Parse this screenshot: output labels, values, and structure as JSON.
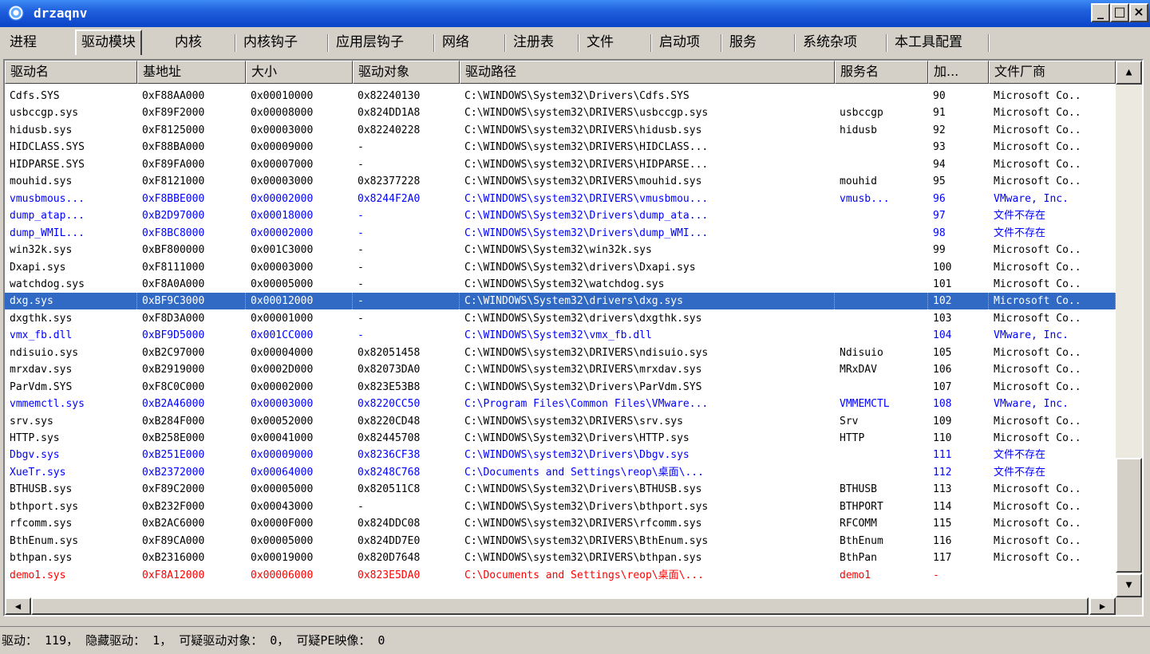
{
  "window": {
    "title": "drzaqnv",
    "minimize": "_",
    "maximize": "□",
    "close": "×"
  },
  "tabs": [
    "进程",
    "驱动模块",
    "内核",
    "内核钩子",
    "应用层钩子",
    "网络",
    "注册表",
    "文件",
    "启动项",
    "服务",
    "系统杂项",
    "本工具配置"
  ],
  "active_tab": "驱动模块",
  "columns": [
    "驱动名",
    "基地址",
    "大小",
    "驱动对象",
    "驱动路径",
    "服务名",
    "加...",
    "文件厂商"
  ],
  "colors": {
    "normal": "#000000",
    "blue": "#0000ff",
    "red": "#ff0000",
    "selected_bg": "#316ac5"
  },
  "rows": [
    {
      "name": "Cdfs.SYS",
      "base": "0xF88AA000",
      "size": "0x00010000",
      "obj": "0x82240130",
      "path": "C:\\WINDOWS\\System32\\Drivers\\Cdfs.SYS",
      "svc": "",
      "load": "90",
      "vendor": "Microsoft Co..",
      "color": "normal"
    },
    {
      "name": "usbccgp.sys",
      "base": "0xF89F2000",
      "size": "0x00008000",
      "obj": "0x824DD1A8",
      "path": "C:\\WINDOWS\\system32\\DRIVERS\\usbccgp.sys",
      "svc": "usbccgp",
      "load": "91",
      "vendor": "Microsoft Co..",
      "color": "normal"
    },
    {
      "name": "hidusb.sys",
      "base": "0xF8125000",
      "size": "0x00003000",
      "obj": "0x82240228",
      "path": "C:\\WINDOWS\\system32\\DRIVERS\\hidusb.sys",
      "svc": "hidusb",
      "load": "92",
      "vendor": "Microsoft Co..",
      "color": "normal"
    },
    {
      "name": "HIDCLASS.SYS",
      "base": "0xF88BA000",
      "size": "0x00009000",
      "obj": "-",
      "path": "C:\\WINDOWS\\system32\\DRIVERS\\HIDCLASS...",
      "svc": "",
      "load": "93",
      "vendor": "Microsoft Co..",
      "color": "normal"
    },
    {
      "name": "HIDPARSE.SYS",
      "base": "0xF89FA000",
      "size": "0x00007000",
      "obj": "-",
      "path": "C:\\WINDOWS\\system32\\DRIVERS\\HIDPARSE...",
      "svc": "",
      "load": "94",
      "vendor": "Microsoft Co..",
      "color": "normal"
    },
    {
      "name": "mouhid.sys",
      "base": "0xF8121000",
      "size": "0x00003000",
      "obj": "0x82377228",
      "path": "C:\\WINDOWS\\system32\\DRIVERS\\mouhid.sys",
      "svc": "mouhid",
      "load": "95",
      "vendor": "Microsoft Co..",
      "color": "normal"
    },
    {
      "name": "vmusbmous...",
      "base": "0xF8BBE000",
      "size": "0x00002000",
      "obj": "0x8244F2A0",
      "path": "C:\\WINDOWS\\system32\\DRIVERS\\vmusbmou...",
      "svc": "vmusb...",
      "load": "96",
      "vendor": "VMware, Inc.",
      "color": "blue"
    },
    {
      "name": "dump_atap...",
      "base": "0xB2D97000",
      "size": "0x00018000",
      "obj": "-",
      "path": "C:\\WINDOWS\\System32\\Drivers\\dump_ata...",
      "svc": "",
      "load": "97",
      "vendor": "文件不存在",
      "color": "blue"
    },
    {
      "name": "dump_WMIL...",
      "base": "0xF8BC8000",
      "size": "0x00002000",
      "obj": "-",
      "path": "C:\\WINDOWS\\System32\\Drivers\\dump_WMI...",
      "svc": "",
      "load": "98",
      "vendor": "文件不存在",
      "color": "blue"
    },
    {
      "name": "win32k.sys",
      "base": "0xBF800000",
      "size": "0x001C3000",
      "obj": "-",
      "path": "C:\\WINDOWS\\System32\\win32k.sys",
      "svc": "",
      "load": "99",
      "vendor": "Microsoft Co..",
      "color": "normal"
    },
    {
      "name": "Dxapi.sys",
      "base": "0xF8111000",
      "size": "0x00003000",
      "obj": "-",
      "path": "C:\\WINDOWS\\System32\\drivers\\Dxapi.sys",
      "svc": "",
      "load": "100",
      "vendor": "Microsoft Co..",
      "color": "normal"
    },
    {
      "name": "watchdog.sys",
      "base": "0xF8A0A000",
      "size": "0x00005000",
      "obj": "-",
      "path": "C:\\WINDOWS\\System32\\watchdog.sys",
      "svc": "",
      "load": "101",
      "vendor": "Microsoft Co..",
      "color": "normal"
    },
    {
      "name": "dxg.sys",
      "base": "0xBF9C3000",
      "size": "0x00012000",
      "obj": "-",
      "path": "C:\\WINDOWS\\System32\\drivers\\dxg.sys",
      "svc": "",
      "load": "102",
      "vendor": "Microsoft Co..",
      "color": "normal",
      "selected": true
    },
    {
      "name": "dxgthk.sys",
      "base": "0xF8D3A000",
      "size": "0x00001000",
      "obj": "-",
      "path": "C:\\WINDOWS\\System32\\drivers\\dxgthk.sys",
      "svc": "",
      "load": "103",
      "vendor": "Microsoft Co..",
      "color": "normal"
    },
    {
      "name": "vmx_fb.dll",
      "base": "0xBF9D5000",
      "size": "0x001CC000",
      "obj": "-",
      "path": "C:\\WINDOWS\\System32\\vmx_fb.dll",
      "svc": "",
      "load": "104",
      "vendor": "VMware, Inc.",
      "color": "blue"
    },
    {
      "name": "ndisuio.sys",
      "base": "0xB2C97000",
      "size": "0x00004000",
      "obj": "0x82051458",
      "path": "C:\\WINDOWS\\system32\\DRIVERS\\ndisuio.sys",
      "svc": "Ndisuio",
      "load": "105",
      "vendor": "Microsoft Co..",
      "color": "normal"
    },
    {
      "name": "mrxdav.sys",
      "base": "0xB2919000",
      "size": "0x0002D000",
      "obj": "0x82073DA0",
      "path": "C:\\WINDOWS\\system32\\DRIVERS\\mrxdav.sys",
      "svc": "MRxDAV",
      "load": "106",
      "vendor": "Microsoft Co..",
      "color": "normal"
    },
    {
      "name": "ParVdm.SYS",
      "base": "0xF8C0C000",
      "size": "0x00002000",
      "obj": "0x823E53B8",
      "path": "C:\\WINDOWS\\System32\\Drivers\\ParVdm.SYS",
      "svc": "",
      "load": "107",
      "vendor": "Microsoft Co..",
      "color": "normal"
    },
    {
      "name": "vmmemctl.sys",
      "base": "0xB2A46000",
      "size": "0x00003000",
      "obj": "0x8220CC50",
      "path": "C:\\Program Files\\Common Files\\VMware...",
      "svc": "VMMEMCTL",
      "load": "108",
      "vendor": "VMware, Inc.",
      "color": "blue"
    },
    {
      "name": "srv.sys",
      "base": "0xB284F000",
      "size": "0x00052000",
      "obj": "0x8220CD48",
      "path": "C:\\WINDOWS\\system32\\DRIVERS\\srv.sys",
      "svc": "Srv",
      "load": "109",
      "vendor": "Microsoft Co..",
      "color": "normal"
    },
    {
      "name": "HTTP.sys",
      "base": "0xB258E000",
      "size": "0x00041000",
      "obj": "0x82445708",
      "path": "C:\\WINDOWS\\System32\\Drivers\\HTTP.sys",
      "svc": "HTTP",
      "load": "110",
      "vendor": "Microsoft Co..",
      "color": "normal"
    },
    {
      "name": "Dbgv.sys",
      "base": "0xB251E000",
      "size": "0x00009000",
      "obj": "0x8236CF38",
      "path": "C:\\WINDOWS\\system32\\Drivers\\Dbgv.sys",
      "svc": "",
      "load": "111",
      "vendor": "文件不存在",
      "color": "blue"
    },
    {
      "name": "XueTr.sys",
      "base": "0xB2372000",
      "size": "0x00064000",
      "obj": "0x8248C768",
      "path": "C:\\Documents and Settings\\reop\\桌面\\...",
      "svc": "",
      "load": "112",
      "vendor": "文件不存在",
      "color": "blue"
    },
    {
      "name": "BTHUSB.sys",
      "base": "0xF89C2000",
      "size": "0x00005000",
      "obj": "0x820511C8",
      "path": "C:\\WINDOWS\\System32\\Drivers\\BTHUSB.sys",
      "svc": "BTHUSB",
      "load": "113",
      "vendor": "Microsoft Co..",
      "color": "normal"
    },
    {
      "name": "bthport.sys",
      "base": "0xB232F000",
      "size": "0x00043000",
      "obj": "-",
      "path": "C:\\WINDOWS\\System32\\Drivers\\bthport.sys",
      "svc": "BTHPORT",
      "load": "114",
      "vendor": "Microsoft Co..",
      "color": "normal"
    },
    {
      "name": "rfcomm.sys",
      "base": "0xB2AC6000",
      "size": "0x0000F000",
      "obj": "0x824DDC08",
      "path": "C:\\WINDOWS\\system32\\DRIVERS\\rfcomm.sys",
      "svc": "RFCOMM",
      "load": "115",
      "vendor": "Microsoft Co..",
      "color": "normal"
    },
    {
      "name": "BthEnum.sys",
      "base": "0xF89CA000",
      "size": "0x00005000",
      "obj": "0x824DD7E0",
      "path": "C:\\WINDOWS\\system32\\DRIVERS\\BthEnum.sys",
      "svc": "BthEnum",
      "load": "116",
      "vendor": "Microsoft Co..",
      "color": "normal"
    },
    {
      "name": "bthpan.sys",
      "base": "0xB2316000",
      "size": "0x00019000",
      "obj": "0x820D7648",
      "path": "C:\\WINDOWS\\system32\\DRIVERS\\bthpan.sys",
      "svc": "BthPan",
      "load": "117",
      "vendor": "Microsoft Co..",
      "color": "normal"
    },
    {
      "name": "demo1.sys",
      "base": "0xF8A12000",
      "size": "0x00006000",
      "obj": "0x823E5DA0",
      "path": "C:\\Documents and Settings\\reop\\桌面\\...",
      "svc": "demo1",
      "load": "-",
      "vendor": "",
      "color": "red"
    }
  ],
  "status": "驱动： 119， 隐藏驱动： 1， 可疑驱动对象： 0， 可疑PE映像： 0",
  "icons": {
    "scroll_up": "▲",
    "scroll_down": "▼",
    "scroll_left": "◀",
    "scroll_right": "▶"
  }
}
